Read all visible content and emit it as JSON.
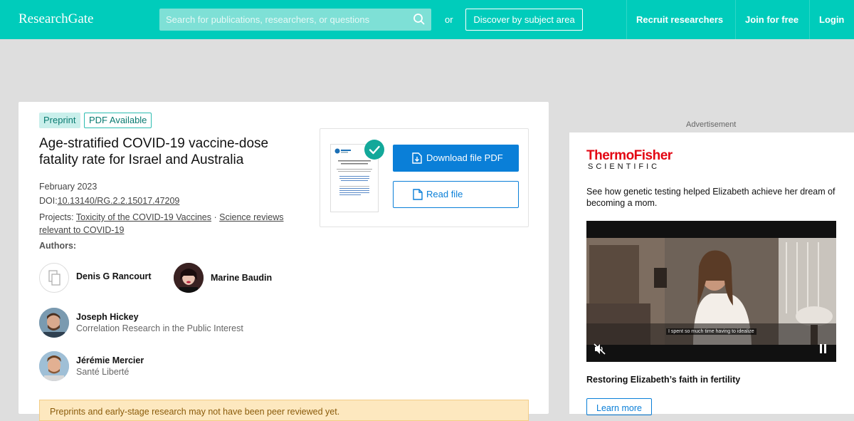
{
  "header": {
    "logo": "ResearchGate",
    "search_placeholder": "Search for publications, researchers, or questions",
    "or_text": "or",
    "discover_label": "Discover by subject area",
    "nav": [
      "Recruit researchers",
      "Join for free",
      "Login"
    ],
    "accent_color": "#00ccbb"
  },
  "publication": {
    "badges": [
      "Preprint",
      "PDF Available"
    ],
    "title": "Age-stratified COVID-19 vaccine-dose fatality rate for Israel and Australia",
    "date": "February 2023",
    "doi_prefix": "DOI:",
    "doi": "10.13140/RG.2.2.15017.47209",
    "projects_prefix": "Projects:",
    "project_1": "Toxicity of the COVID-19 Vaccines",
    "project_separator": "·",
    "project_2": "Science reviews relevant to COVID-19",
    "authors_label": "Authors:",
    "authors": [
      {
        "name": "Denis G Rancourt",
        "affiliation": ""
      },
      {
        "name": "Marine Baudin",
        "affiliation": ""
      },
      {
        "name": "Joseph Hickey",
        "affiliation": "Correlation Research in the Public Interest"
      },
      {
        "name": "Jérémie Mercier",
        "affiliation": "Santé Liberté"
      }
    ],
    "download_label": "Download file PDF",
    "read_label": "Read file",
    "notice": "Preprints and early-stage research may not have been peer reviewed yet."
  },
  "advertisement": {
    "label": "Advertisement",
    "brand_top": "ThermoFisher",
    "brand_bottom": "SCIENTIFIC",
    "description": "See how genetic testing helped Elizabeth achieve her dream of becoming a mom.",
    "video_caption": "I spent so much time having to idealize",
    "headline": "Restoring Elizabeth’s faith in fertility",
    "cta": "Learn more"
  }
}
